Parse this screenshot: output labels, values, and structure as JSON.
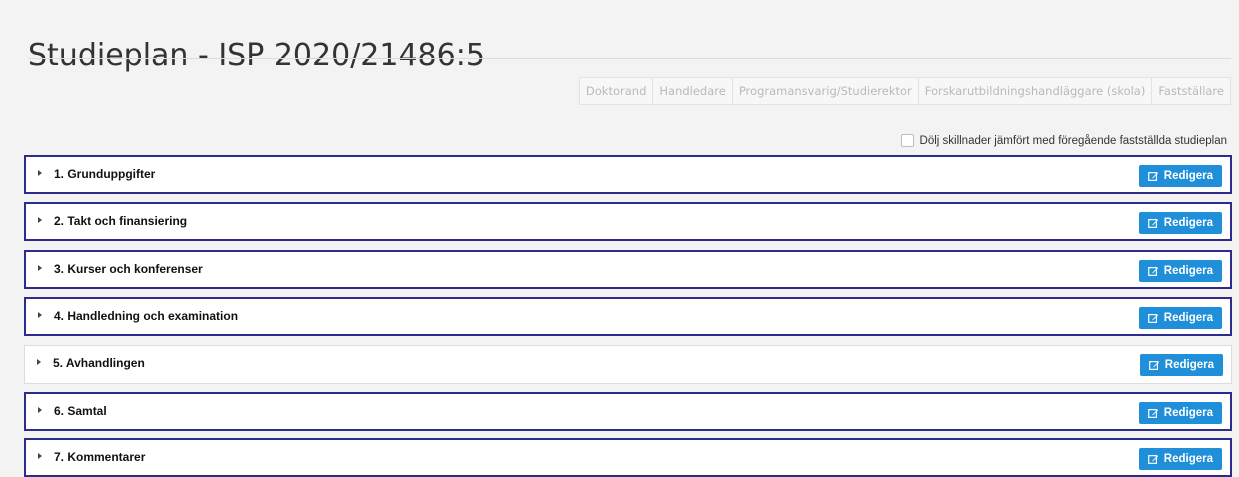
{
  "page": {
    "title": "Studieplan - ISP 2020/21486:5"
  },
  "roles": [
    "Doktorand",
    "Handledare",
    "Programansvarig/Studierektor",
    "Forskarutbildningshandläggare (skola)",
    "Fastställare"
  ],
  "diff_option": {
    "label": "Dölj skillnader jämfört med föregående fastställda studieplan",
    "checked": false
  },
  "sections": [
    {
      "label": "1. Grunduppgifter",
      "edit_label": "Redigera",
      "highlighted": true
    },
    {
      "label": "2. Takt och finansiering",
      "edit_label": "Redigera",
      "highlighted": true
    },
    {
      "label": "3. Kurser och konferenser",
      "edit_label": "Redigera",
      "highlighted": true
    },
    {
      "label": "4. Handledning och examination",
      "edit_label": "Redigera",
      "highlighted": true
    },
    {
      "label": "5. Avhandlingen",
      "edit_label": "Redigera",
      "highlighted": false
    },
    {
      "label": "6. Samtal",
      "edit_label": "Redigera",
      "highlighted": true
    },
    {
      "label": "7. Kommentarer",
      "edit_label": "Redigera",
      "highlighted": true
    }
  ],
  "colors": {
    "highlight_border": "#2e2b8f",
    "button": "#1e8fd8"
  },
  "icons": {
    "section_toggle": "caret-right-icon",
    "edit": "edit-icon"
  }
}
